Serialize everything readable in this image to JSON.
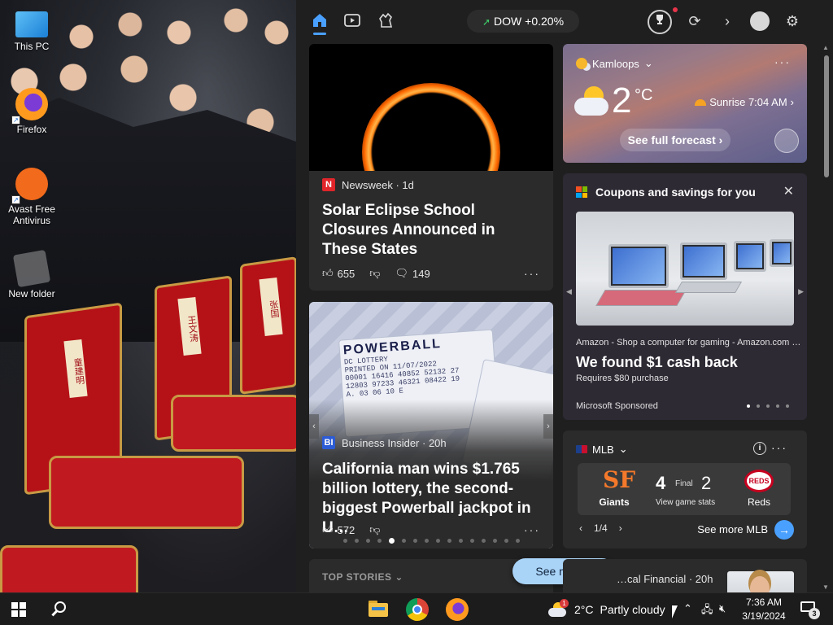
{
  "desktop": {
    "icons": [
      {
        "label": "This PC"
      },
      {
        "label": "Firefox"
      },
      {
        "label": "Avast Free\nAntivirus"
      },
      {
        "label": "New folder"
      }
    ],
    "chair_tags": [
      "童建明",
      "王文涛",
      "张国"
    ]
  },
  "widgets": {
    "topbar": {
      "market": {
        "symbol": "DOW",
        "change": "+0.20%",
        "direction": "up",
        "color": "#3ecf6a"
      },
      "icons": [
        "home-icon",
        "video-icon",
        "games-icon",
        "trophy-icon",
        "refresh-icon",
        "chevron-right-icon",
        "profile-icon",
        "gear-icon"
      ],
      "accent": "#4aa0ff"
    },
    "news": [
      {
        "source": "Newsweek",
        "age": "1d",
        "headline": "Solar Eclipse School Closures Announced in These States",
        "likes": "655",
        "comments": "149"
      },
      {
        "source": "Business Insider",
        "age": "20h",
        "headline": "California man wins $1.765 billion lottery, the second-biggest Powerball jackpot in U…",
        "likes": "572",
        "ticket": {
          "brand": "POWERBALL",
          "issuer": "DC LOTTERY",
          "printed": "PRINTED ON 11/07/2022",
          "line1": "00001 16416 40852 52132 27",
          "line2": "12803 97233 46321 08422 19",
          "numbers": "A. 03 06 10 E"
        },
        "carousel": {
          "count": 16,
          "active": 4
        }
      }
    ],
    "top_stories": {
      "label": "TOP STORIES"
    },
    "see_more": {
      "label": "See more"
    },
    "weather": {
      "location": "Kamloops",
      "temp": "2",
      "unit": "°C",
      "sunrise": "Sunrise 7:04 AM",
      "forecast_button": "See full forecast"
    },
    "coupons": {
      "title": "Coupons and savings for you",
      "source": "Amazon - Shop a computer for gaming - Amazon.com …",
      "headline": "We found $1 cash back",
      "requirement": "Requires $80 purchase",
      "sponsor": "Microsoft Sponsored",
      "carousel": {
        "count": 5,
        "active": 0
      }
    },
    "mlb": {
      "title": "MLB",
      "home": {
        "name": "Giants",
        "score": "4",
        "logo": "SF"
      },
      "away": {
        "name": "Reds",
        "score": "2",
        "logo": "REDS"
      },
      "status": "Final",
      "stats_link": "View game stats",
      "pager": "1/4",
      "see_more": "See more MLB"
    },
    "financial": {
      "source": "…cal Financial · 20h"
    }
  },
  "taskbar": {
    "weather": {
      "temp": "2°C",
      "condition": "Partly cloudy",
      "badge": "1"
    },
    "time": "7:36 AM",
    "date": "3/19/2024",
    "notifications": "3"
  }
}
